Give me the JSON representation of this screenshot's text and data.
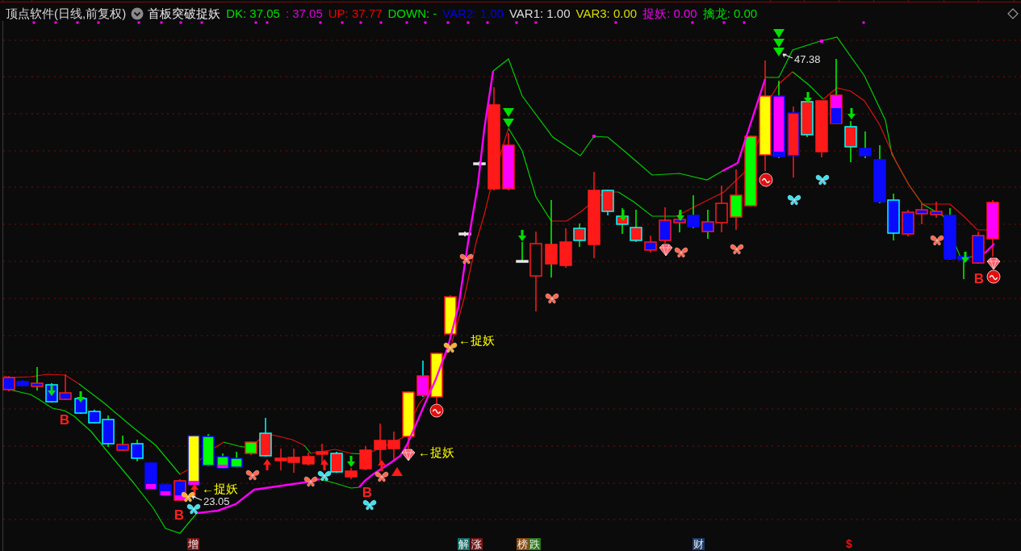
{
  "header": {
    "title": "顶点软件(日线,前复权)",
    "indicator": "首板突破捉妖",
    "readouts": [
      {
        "text": "DK: 37.05",
        "color": "#00dd00"
      },
      {
        "text": ": 37.05",
        "color": "#dd00dd"
      },
      {
        "text": "UP: 37.77",
        "color": "#ee0000"
      },
      {
        "text": "DOWN: -",
        "color": "#00dd00"
      },
      {
        "text": "VAR2: 1.00",
        "color": "#0000ee"
      },
      {
        "text": "VAR1: 1.00",
        "color": "#dddddd"
      },
      {
        "text": "VAR3: 0.00",
        "color": "#dddd00"
      },
      {
        "text": "捉妖: 0.00",
        "color": "#ee00ee"
      },
      {
        "text": "擒龙: 0.00",
        "color": "#00dd00"
      }
    ]
  },
  "chart": {
    "labels": [
      {
        "kind": "signal",
        "text": "B"
      },
      {
        "kind": "signal",
        "text": "B"
      },
      {
        "kind": "callout",
        "text": "←捉妖"
      },
      {
        "kind": "price",
        "text": "23.05"
      },
      {
        "kind": "signal",
        "text": "B"
      },
      {
        "kind": "callout",
        "text": "←捉妖"
      },
      {
        "kind": "callout",
        "text": "←捉妖"
      },
      {
        "kind": "price",
        "text": "47.38"
      },
      {
        "kind": "signal",
        "text": "B"
      }
    ],
    "event_tags": [
      {
        "kind": "tag",
        "text": "增",
        "color": "#7a1414"
      },
      {
        "kind": "tag",
        "text": "解",
        "color": "#13706a"
      },
      {
        "kind": "tag",
        "text": "涨",
        "color": "#7a1414"
      },
      {
        "kind": "tag",
        "text": "榜",
        "color": "#8a4a10"
      },
      {
        "kind": "tag",
        "text": "跌",
        "color": "#2a7a1a"
      },
      {
        "kind": "tag",
        "text": "财",
        "color": "#1a3a6a"
      },
      {
        "kind": "symbol",
        "text": "$",
        "color": "#ee1010"
      }
    ]
  }
}
